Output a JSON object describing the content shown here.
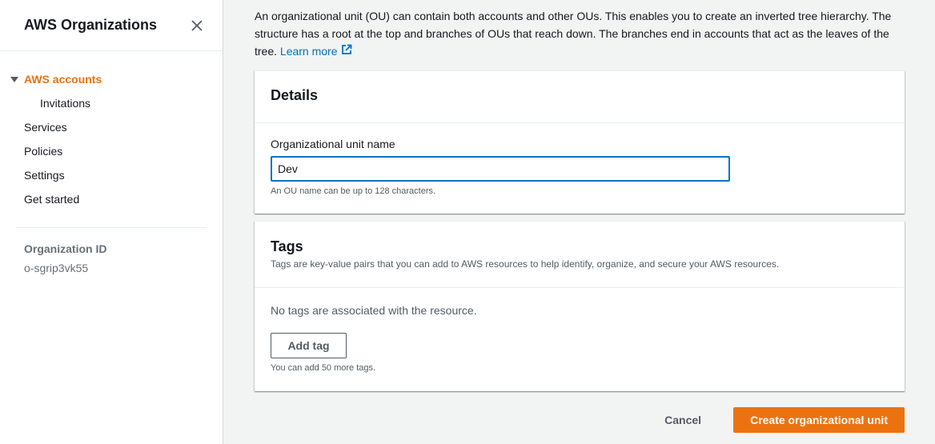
{
  "sidebar": {
    "title": "AWS Organizations",
    "close_icon": "close-icon",
    "items": [
      {
        "label": "AWS accounts",
        "active": true
      },
      {
        "label": "Invitations",
        "sub": true
      },
      {
        "label": "Services"
      },
      {
        "label": "Policies"
      },
      {
        "label": "Settings"
      },
      {
        "label": "Get started"
      }
    ],
    "org_id_label": "Organization ID",
    "org_id_value": "o-sgrip3vk55"
  },
  "main": {
    "intro_text": "An organizational unit (OU) can contain both accounts and other OUs. This enables you to create an inverted tree hierarchy. The structure has a root at the top and branches of OUs that reach down. The branches end in accounts that act as the leaves of the tree.",
    "learn_more": "Learn more",
    "details": {
      "title": "Details",
      "field_label": "Organizational unit name",
      "field_value": "Dev",
      "hint": "An OU name can be up to 128 characters."
    },
    "tags": {
      "title": "Tags",
      "description": "Tags are key-value pairs that you can add to AWS resources to help identify, organize, and secure your AWS resources.",
      "empty_message": "No tags are associated with the resource.",
      "add_button": "Add tag",
      "hint": "You can add 50 more tags."
    },
    "actions": {
      "cancel": "Cancel",
      "create": "Create organizational unit"
    }
  },
  "colors": {
    "accent": "#ec7211",
    "link": "#0073bb",
    "focus_border": "#0073bb"
  }
}
